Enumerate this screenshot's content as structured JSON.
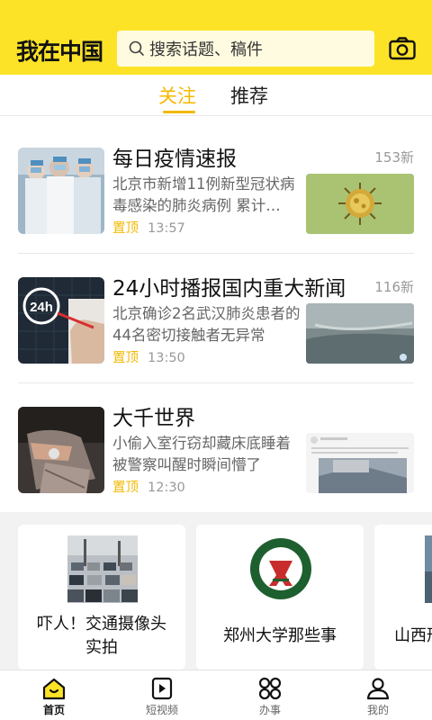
{
  "header": {
    "logo": "我在中国",
    "search_placeholder": "搜索话题、稿件"
  },
  "tabs": [
    {
      "label": "关注",
      "active": true
    },
    {
      "label": "推荐",
      "active": false
    }
  ],
  "feed": [
    {
      "title": "每日疫情速报",
      "count": "153新",
      "desc": "北京市新增11例新型冠状病毒感染的肺炎病例 累计…",
      "pin": "置顶",
      "time": "13:57"
    },
    {
      "title": "24小时播报国内重大新闻",
      "count": "116新",
      "desc": "北京确诊2名武汉肺炎患者的44名密切接触者无异常",
      "pin": "置顶",
      "time": "13:50",
      "thumb_text": "24h"
    },
    {
      "title": "大千世界",
      "count": "",
      "desc": "小偷入室行窃却藏床底睡着被警察叫醒时瞬间懵了",
      "pin": "置顶",
      "time": "12:30"
    }
  ],
  "cards": [
    {
      "label": "吓人！交通摄像头实拍"
    },
    {
      "label": "郑州大学那些事"
    },
    {
      "label": "山西形"
    }
  ],
  "nav": [
    {
      "label": "首页",
      "icon": "home-icon",
      "active": true
    },
    {
      "label": "短视频",
      "icon": "play-icon",
      "active": false
    },
    {
      "label": "办事",
      "icon": "grid-icon",
      "active": false
    },
    {
      "label": "我的",
      "icon": "user-icon",
      "active": false
    }
  ],
  "colors": {
    "accent": "#fde327",
    "highlight": "#f3b800"
  }
}
